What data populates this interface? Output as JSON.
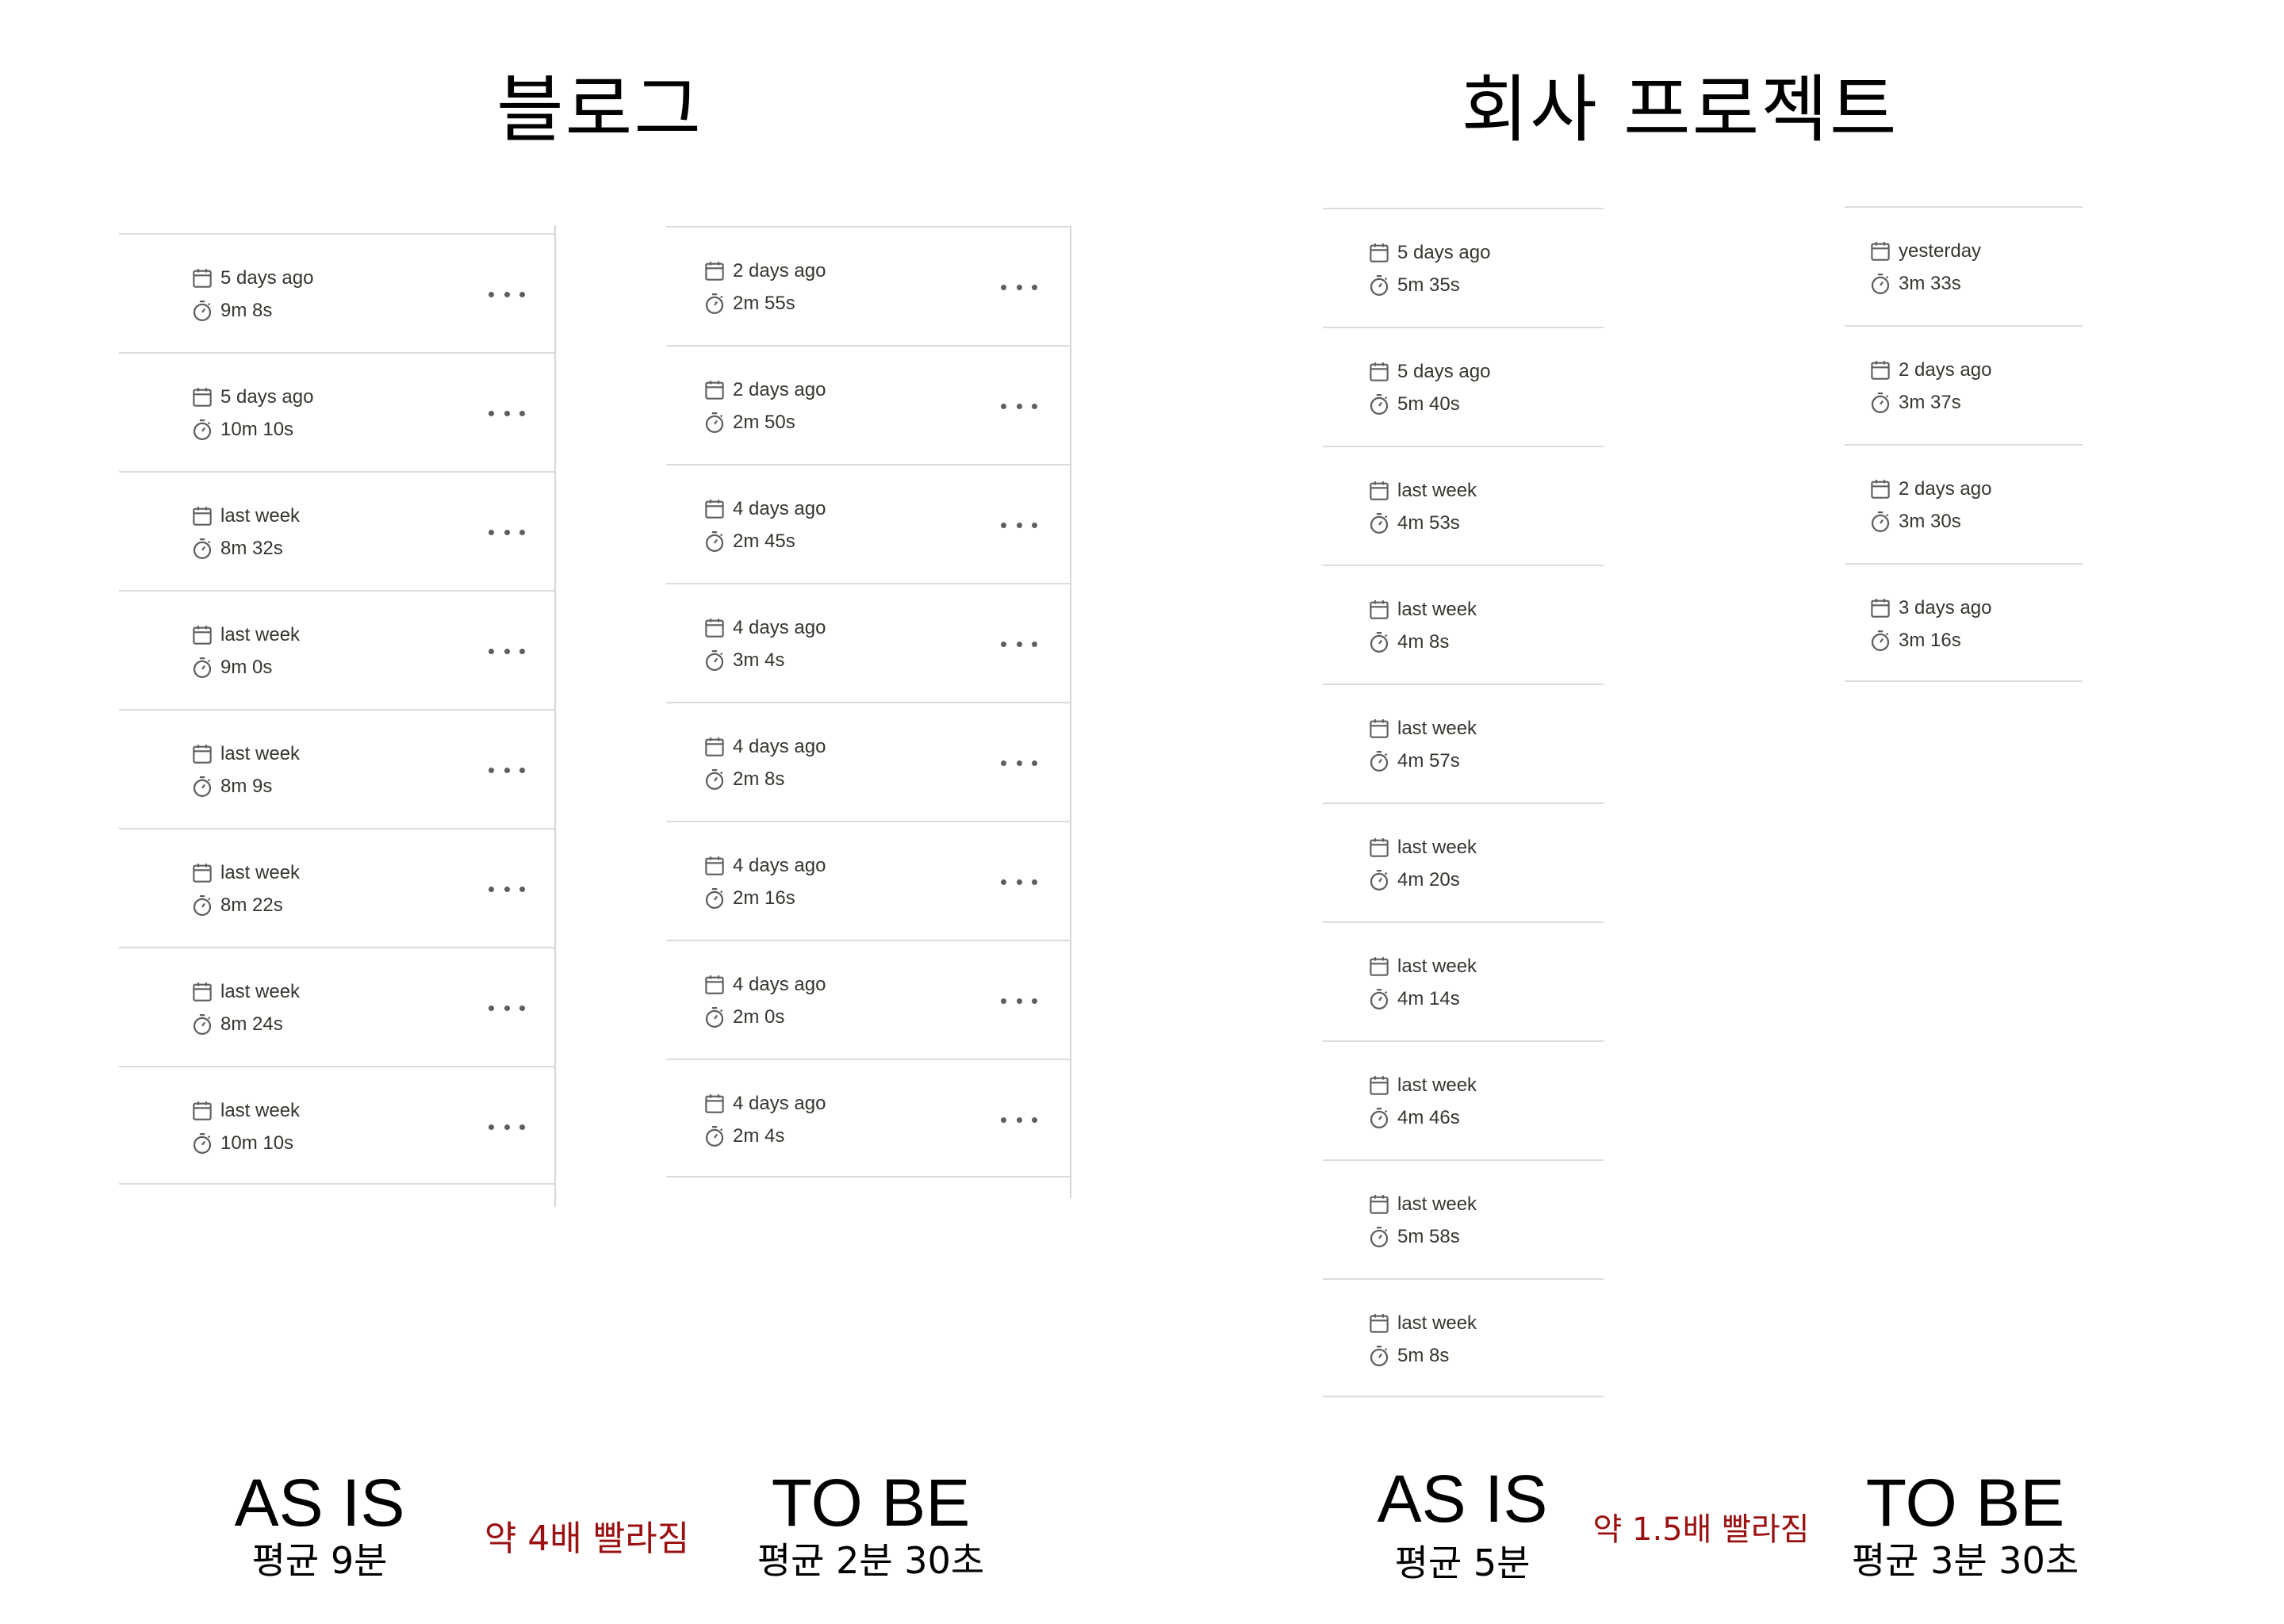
{
  "blog": {
    "title": "블로그",
    "as_is": {
      "rows": [
        {
          "date": "5 days ago",
          "duration": "9m 8s"
        },
        {
          "date": "5 days ago",
          "duration": "10m 10s"
        },
        {
          "date": "last week",
          "duration": "8m 32s"
        },
        {
          "date": "last week",
          "duration": "9m 0s"
        },
        {
          "date": "last week",
          "duration": "8m 9s"
        },
        {
          "date": "last week",
          "duration": "8m 22s"
        },
        {
          "date": "last week",
          "duration": "8m 24s"
        },
        {
          "date": "last week",
          "duration": "10m 10s"
        }
      ],
      "label": "AS IS",
      "average": "평균 9분"
    },
    "to_be": {
      "rows": [
        {
          "date": "2 days ago",
          "duration": "2m 55s"
        },
        {
          "date": "2 days ago",
          "duration": "2m 50s"
        },
        {
          "date": "4 days ago",
          "duration": "2m 45s"
        },
        {
          "date": "4 days ago",
          "duration": "3m 4s"
        },
        {
          "date": "4 days ago",
          "duration": "2m 8s"
        },
        {
          "date": "4 days ago",
          "duration": "2m 16s"
        },
        {
          "date": "4 days ago",
          "duration": "2m 0s"
        },
        {
          "date": "4 days ago",
          "duration": "2m 4s"
        }
      ],
      "label": "TO BE",
      "average": "평균 2분 30초"
    },
    "speedup": "약 4배 빨라짐"
  },
  "company": {
    "title": "회사 프로젝트",
    "as_is": {
      "rows": [
        {
          "date": "5 days ago",
          "duration": "5m 35s"
        },
        {
          "date": "5 days ago",
          "duration": "5m 40s"
        },
        {
          "date": "last week",
          "duration": "4m 53s"
        },
        {
          "date": "last week",
          "duration": "4m 8s"
        },
        {
          "date": "last week",
          "duration": "4m 57s"
        },
        {
          "date": "last week",
          "duration": "4m 20s"
        },
        {
          "date": "last week",
          "duration": "4m 14s"
        },
        {
          "date": "last week",
          "duration": "4m 46s"
        },
        {
          "date": "last week",
          "duration": "5m 58s"
        },
        {
          "date": "last week",
          "duration": "5m 8s"
        }
      ],
      "label": "AS IS",
      "average": "평균 5분"
    },
    "to_be": {
      "rows": [
        {
          "date": "yesterday",
          "duration": "3m 33s"
        },
        {
          "date": "2 days ago",
          "duration": "3m 37s"
        },
        {
          "date": "2 days ago",
          "duration": "3m 30s"
        },
        {
          "date": "3 days ago",
          "duration": "3m 16s"
        }
      ],
      "label": "TO BE",
      "average": "평균 3분 30초"
    },
    "speedup": "약 1.5배 빨라짐"
  },
  "icons": {
    "date": "calendar-icon",
    "duration": "stopwatch-icon",
    "menu": "more-horizontal-icon"
  },
  "colors": {
    "text": "#37352f",
    "icon": "#5f5e5b",
    "divider": "#dcdcdc",
    "speedup": "#9b1010"
  }
}
